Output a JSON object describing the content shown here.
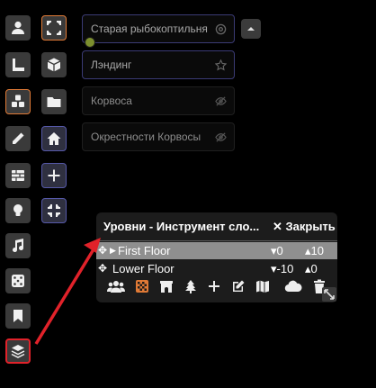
{
  "scenes": [
    {
      "label": "Старая рыбокоптильня"
    },
    {
      "label": "Лэндинг"
    },
    {
      "label": "Корвоса"
    },
    {
      "label": "Окрестности Корвосы"
    }
  ],
  "levels_panel": {
    "title": "Уровни - Инструмент сло...",
    "close_label": "✕ Закрыть",
    "levels": [
      {
        "name": "First Floor",
        "bottom": "▾0",
        "top": "▴10",
        "selected": true
      },
      {
        "name": "Lower Floor",
        "bottom": "▾-10",
        "top": "▴0",
        "selected": false
      }
    ]
  },
  "colors": {
    "accent_orange": "#e07a36",
    "active_blue": "#5558a8",
    "highlight_red": "#e1222a"
  }
}
